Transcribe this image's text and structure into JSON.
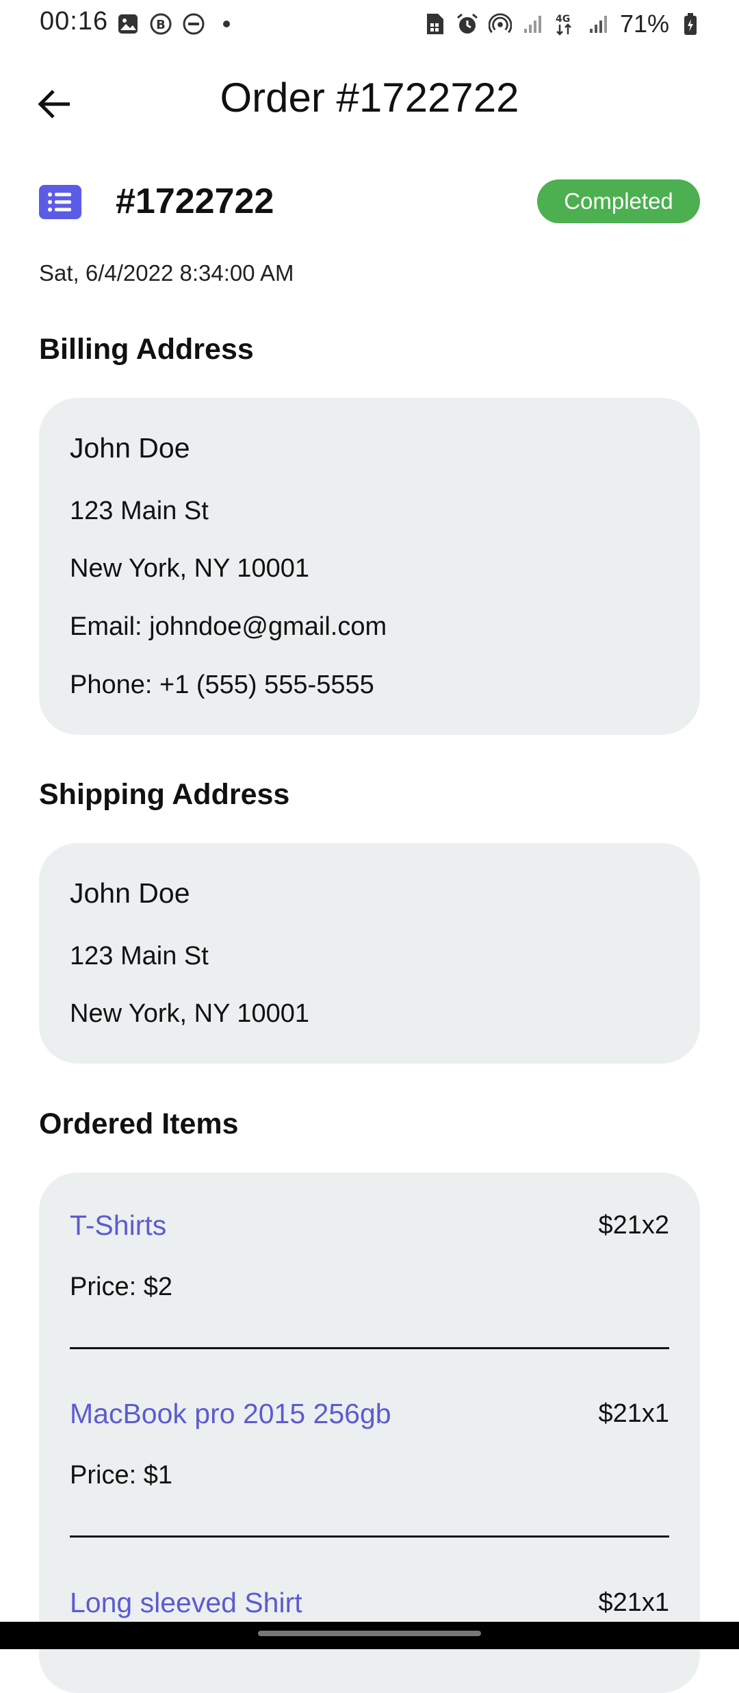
{
  "status_bar": {
    "time": "00:16",
    "battery": "71%",
    "network": "4G",
    "left_icons": [
      "gallery-icon",
      "b-icon",
      "dnd-icon"
    ],
    "right_icons": [
      "sim-icon",
      "alarm-icon",
      "hotspot-icon",
      "signal-icon",
      "signal-4g-icon",
      "battery-icon"
    ]
  },
  "header": {
    "title": "Order #1722722"
  },
  "order": {
    "number": "#1722722",
    "status": "Completed",
    "status_color": "#4caf50",
    "date": "Sat, 6/4/2022 8:34:00 AM"
  },
  "billing": {
    "title": "Billing Address",
    "name": "John Doe",
    "street": "123 Main St",
    "city": "New York, NY 10001",
    "email": "Email: johndoe@gmail.com",
    "phone": "Phone: +1 (555) 555-5555"
  },
  "shipping": {
    "title": "Shipping Address",
    "name": "John Doe",
    "street": "123 Main St",
    "city": "New York, NY 10001"
  },
  "ordered_items": {
    "title": "Ordered Items",
    "items": [
      {
        "name": "T-Shirts",
        "qty": "$21x2",
        "price": "Price: $2"
      },
      {
        "name": "MacBook pro 2015 256gb",
        "qty": "$21x1",
        "price": "Price: $1"
      },
      {
        "name": "Long sleeved Shirt",
        "qty": "$21x1"
      }
    ]
  },
  "colors": {
    "accent": "#5b5ce6",
    "item_link": "#5b5ccf",
    "card_bg": "#eceff0"
  }
}
